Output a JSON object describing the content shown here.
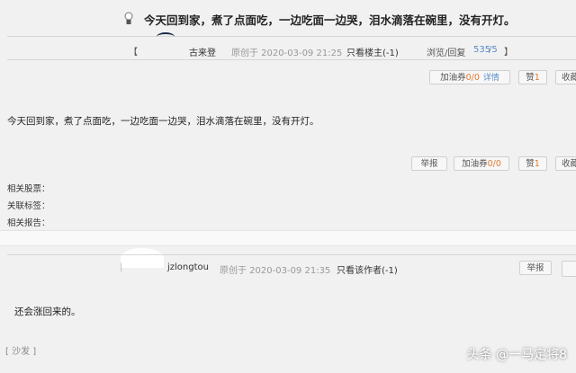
{
  "post": {
    "title": "今天回到家，煮了点面吃，一边吃面一边哭，泪水滴落在碗里，没有开灯。",
    "meta": {
      "bracket_open": "【",
      "author": "古来登",
      "posted": "原创于 2020-03-09 21:25",
      "only_host": "只看楼主(-1)",
      "views_label": "浏览/回复",
      "views": "535",
      "replies": "/5",
      "bracket_close": "】"
    },
    "top_actions": {
      "fuel": "加油券",
      "fuel_count": "0/0",
      "detail": "详情",
      "like": "赞",
      "like_count": "1",
      "collect": "收藏"
    },
    "body": "今天回到家，煮了点面吃，一边吃面一边哭，泪水滴落在碗里，没有开灯。",
    "bottom_actions": {
      "report": "举报",
      "fuel": "加油券",
      "fuel_count": "0/0",
      "like": "赞",
      "like_count": "1",
      "collect": "收藏"
    },
    "related": {
      "stocks": "相关股票：",
      "tags": "关联标签：",
      "reports": "相关报告："
    }
  },
  "reply": {
    "author": "jzlongtou",
    "posted": "原创于 2020-03-09 21:35",
    "only_author": "只看该作者(-1)",
    "report": "举报",
    "body": "还会涨回来的。"
  },
  "sofa": "[ 沙发 ]",
  "watermark": "头条 @一马定将8",
  "colors": {
    "accent_orange": "#e07a2e",
    "link_blue": "#5b8cc7",
    "bg": "#f1f1f1"
  }
}
